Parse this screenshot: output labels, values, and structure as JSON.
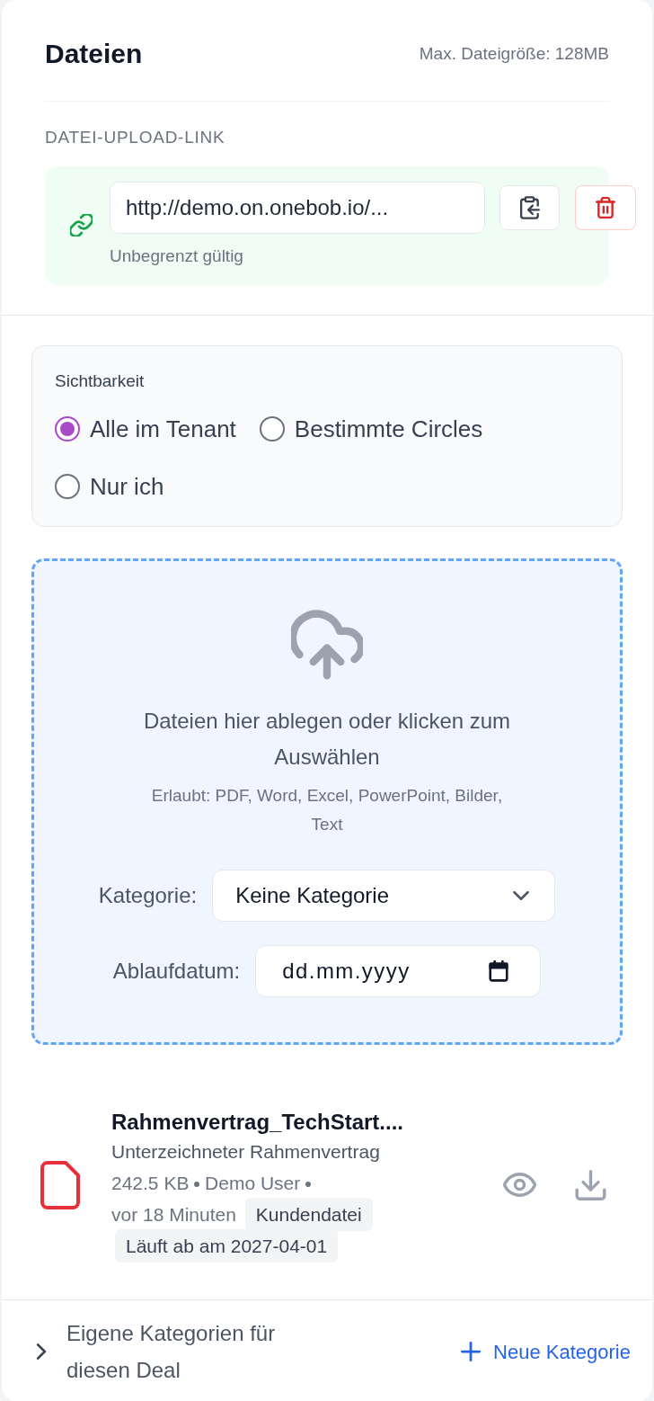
{
  "header": {
    "title": "Dateien",
    "max_size": "Max. Dateigröße: 128MB"
  },
  "upload_link": {
    "heading": "DATEI-UPLOAD-LINK",
    "url": "http://demo.on.onebob.io/...",
    "validity": "Unbegrenzt gültig"
  },
  "visibility": {
    "label": "Sichtbarkeit",
    "options": [
      {
        "label": "Alle im Tenant",
        "selected": true
      },
      {
        "label": "Bestimmte Circles",
        "selected": false
      },
      {
        "label": "Nur ich",
        "selected": false
      }
    ]
  },
  "dropzone": {
    "prompt": "Dateien hier ablegen oder klicken zum Auswählen",
    "allowed": "Erlaubt: PDF, Word, Excel, PowerPoint, Bilder, Text",
    "fields": [
      {
        "kind": "select",
        "label": "Kategorie:",
        "value": "Keine Kategorie"
      },
      {
        "kind": "date",
        "label": "Ablaufdatum:",
        "placeholder": "dd.mm.yyyy"
      }
    ]
  },
  "files": [
    {
      "name": "Rahmenvertrag_TechStart....",
      "description": "Unterzeichneter Rahmenvertrag",
      "meta": [
        "242.5 KB",
        "Demo User",
        "vor 18 Minuten"
      ],
      "tags": [
        "Kundendatei",
        "Läuft ab am 2027-04-01"
      ]
    }
  ],
  "custom_categories": {
    "label": "Eigene Kategorien für diesen Deal",
    "expanded": false,
    "add_button": "Neue Kategorie"
  }
}
